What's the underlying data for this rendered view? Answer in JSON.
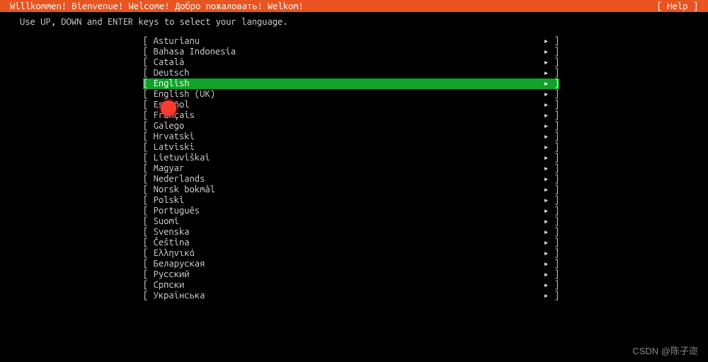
{
  "header": {
    "title": "Willkommen! Bienvenue! Welcome! Добро пожаловать! Welkom!",
    "help_label": "[ Help ]"
  },
  "instruction": "Use UP, DOWN and ENTER keys to select your language.",
  "selected_index": 4,
  "bracket_open": "[ ",
  "arrow_close": "▸ ]",
  "languages": [
    "Asturianu",
    "Bahasa Indonesia",
    "Català",
    "Deutsch",
    "English",
    "English (UK)",
    "Español",
    "Français",
    "Galego",
    "Hrvatski",
    "Latviski",
    "Lietuviškai",
    "Magyar",
    "Nederlands",
    "Norsk bokmål",
    "Polski",
    "Português",
    "Suomi",
    "Svenska",
    "Čeština",
    "Ελληνικά",
    "Беларуская",
    "Русский",
    "Српски",
    "Українська"
  ],
  "footer": {
    "watermark": "CSDN @陈子迩"
  }
}
